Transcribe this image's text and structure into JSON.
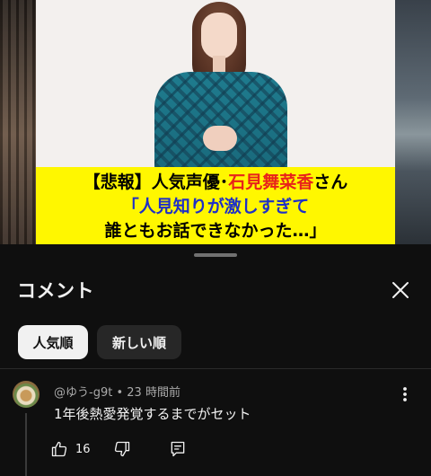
{
  "video": {
    "caption": {
      "line1_part1": "【悲報】人気声優･",
      "line1_name": "石見舞菜香",
      "line1_part2": "さん",
      "line2": "「人見知りが激しすぎて",
      "line3": "誰ともお話できなかった…」"
    },
    "colors": {
      "caption_bg": "#fff700",
      "name_color": "#e8231a",
      "quote_color": "#1e2fc8"
    }
  },
  "sheet": {
    "title": "コメント",
    "close_icon": "close-icon",
    "sort_chips": [
      {
        "label": "人気順",
        "active": true
      },
      {
        "label": "新しい順",
        "active": false
      }
    ]
  },
  "comments": [
    {
      "author": "@ゆう-g9t",
      "time": "23 時間前",
      "text": "1年後熱愛発覚するまでがセット",
      "likes": "16",
      "icons": [
        "thumbs-up-icon",
        "thumbs-down-icon",
        "reply-icon",
        "more-vert-icon"
      ]
    }
  ]
}
